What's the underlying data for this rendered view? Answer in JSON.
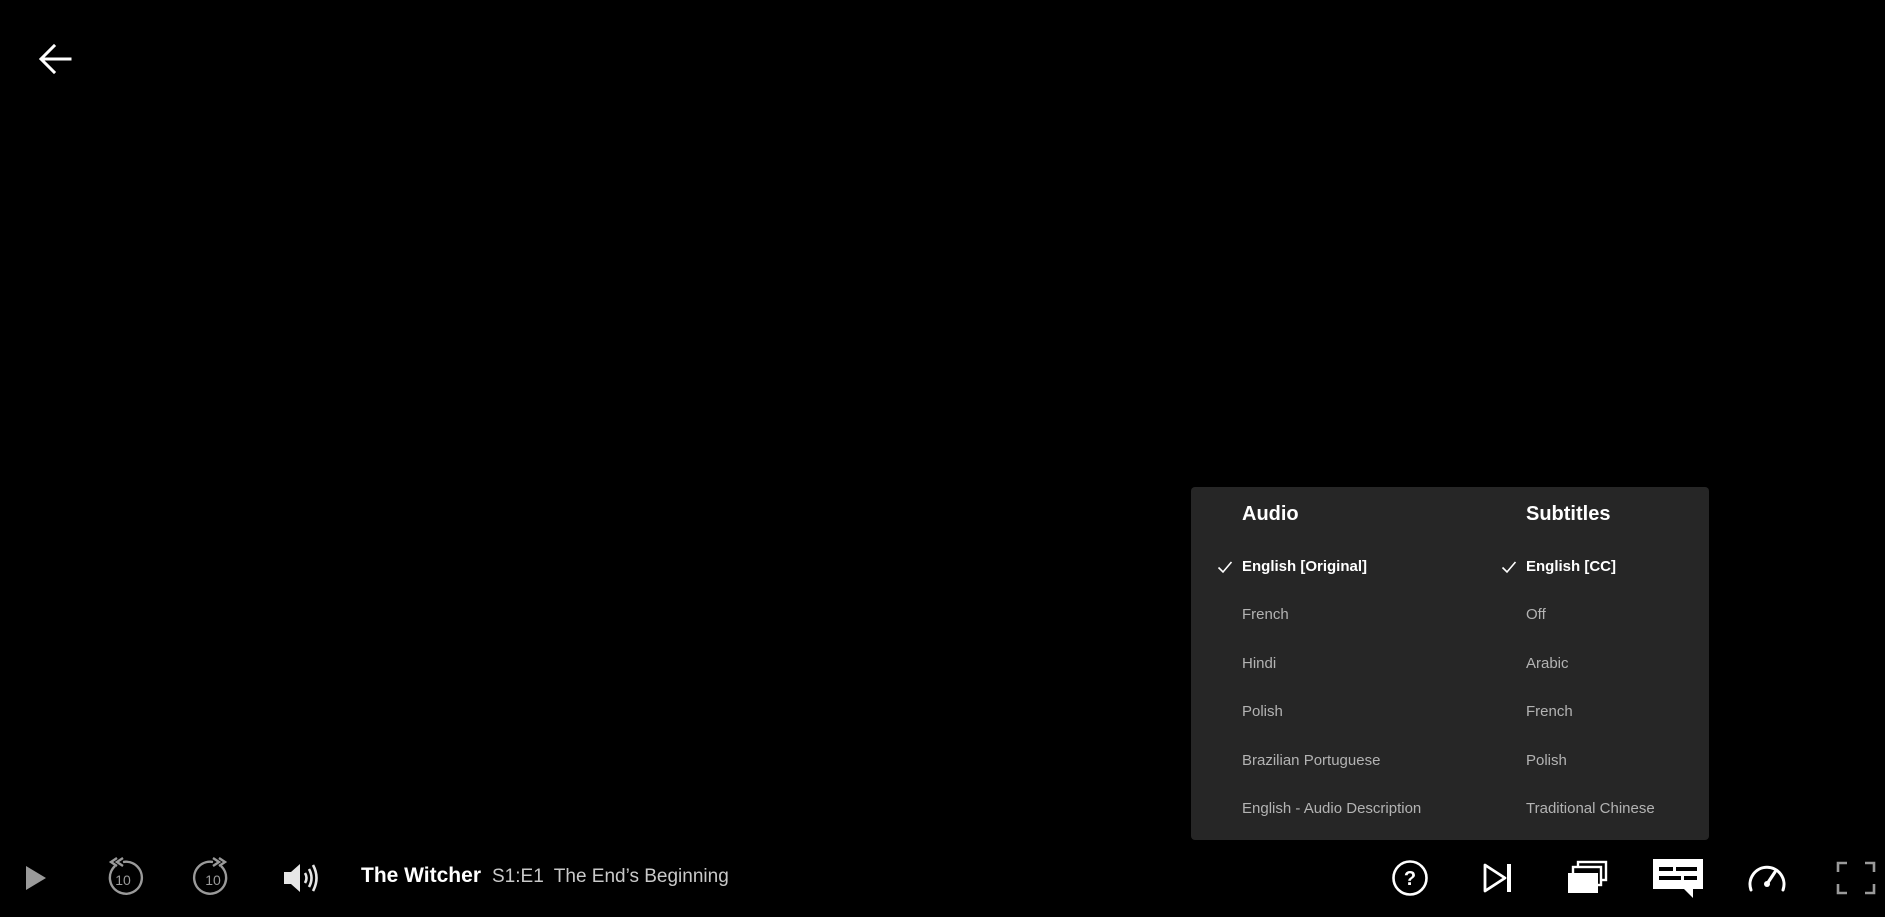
{
  "player": {
    "back_icon": "arrow-left-icon",
    "show_title": "The Witcher",
    "episode_number": "S1:E1",
    "episode_title": "The End’s Beginning"
  },
  "audio_subtitles_panel": {
    "audio": {
      "heading": "Audio",
      "options": [
        {
          "label": "English [Original]",
          "selected": true
        },
        {
          "label": "French",
          "selected": false
        },
        {
          "label": "Hindi",
          "selected": false
        },
        {
          "label": "Polish",
          "selected": false
        },
        {
          "label": "Brazilian Portuguese",
          "selected": false
        },
        {
          "label": "English - Audio Description",
          "selected": false
        }
      ]
    },
    "subtitles": {
      "heading": "Subtitles",
      "options": [
        {
          "label": "English [CC]",
          "selected": true
        },
        {
          "label": "Off",
          "selected": false
        },
        {
          "label": "Arabic",
          "selected": false
        },
        {
          "label": "French",
          "selected": false
        },
        {
          "label": "Polish",
          "selected": false
        },
        {
          "label": "Traditional Chinese",
          "selected": false
        }
      ]
    }
  },
  "controls": {
    "left": [
      "play-icon",
      "rewind-10-icon",
      "forward-10-icon",
      "volume-icon"
    ],
    "right": [
      "help-icon",
      "next-episode-icon",
      "episodes-icon",
      "audio-subtitles-icon",
      "playback-speed-icon",
      "fullscreen-icon"
    ],
    "rewind_seconds": "10",
    "forward_seconds": "10"
  },
  "colors": {
    "background": "#000000",
    "panel_background": "#262626",
    "selected_text": "#ffffff",
    "unselected_text": "#b3b3b3",
    "dim_icon": "#9a9a9a"
  }
}
